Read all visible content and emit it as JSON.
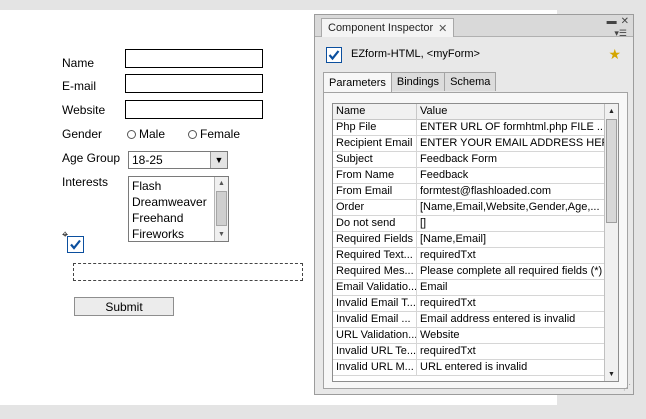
{
  "form": {
    "labels": {
      "name": "Name",
      "email": "E-mail",
      "website": "Website",
      "gender": "Gender",
      "age_group": "Age Group",
      "interests": "Interests"
    },
    "gender_options": [
      "Male",
      "Female"
    ],
    "age_group_value": "18-25",
    "interests": [
      "Flash",
      "Dreamweaver",
      "Freehand",
      "Fireworks"
    ],
    "submit_label": "Submit"
  },
  "inspector": {
    "panel_title": "Component Inspector",
    "component_name": "EZform-HTML, <myForm>",
    "tabs": [
      "Parameters",
      "Bindings",
      "Schema"
    ],
    "columns": [
      "Name",
      "Value"
    ],
    "rows": [
      {
        "name": "Php File",
        "value": "ENTER URL OF formhtml.php FILE ..."
      },
      {
        "name": "Recipient Email",
        "value": "ENTER YOUR EMAIL ADDRESS HERE"
      },
      {
        "name": "Subject",
        "value": "Feedback Form"
      },
      {
        "name": "From Name",
        "value": "Feedback"
      },
      {
        "name": "From Email",
        "value": "formtest@flashloaded.com"
      },
      {
        "name": "Order",
        "value": "[Name,Email,Website,Gender,Age,..."
      },
      {
        "name": "Do not send",
        "value": "[]"
      },
      {
        "name": "Required Fields",
        "value": "[Name,Email]"
      },
      {
        "name": "Required Text...",
        "value": "requiredTxt"
      },
      {
        "name": "Required Mes...",
        "value": "Please complete all required fields (*)"
      },
      {
        "name": "Email Validatio...",
        "value": "Email"
      },
      {
        "name": "Invalid Email T...",
        "value": "requiredTxt"
      },
      {
        "name": "Invalid Email ...",
        "value": "Email address entered is invalid"
      },
      {
        "name": "URL Validation...",
        "value": "Website"
      },
      {
        "name": "Invalid URL Te...",
        "value": "requiredTxt"
      },
      {
        "name": "Invalid URL M...",
        "value": "URL entered is invalid"
      }
    ]
  },
  "colors": {
    "stage": "#ffffff",
    "checkbox_blue": "#0b4f9e"
  }
}
